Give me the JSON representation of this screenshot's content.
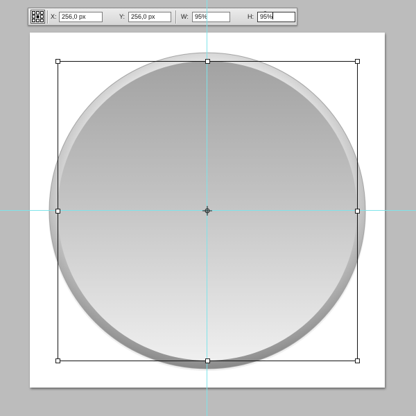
{
  "options_bar": {
    "x_label": "X:",
    "x_value": "256,0 px",
    "y_label": "Y:",
    "y_value": "256,0 px",
    "w_label": "W:",
    "w_value": "95%",
    "h_label": "H:",
    "h_value": "95%",
    "reference_point_icon": "reference-point-grid-icon",
    "relative_positioning_icon": "delta-icon",
    "link_icon": "chain-link-icon"
  },
  "canvas": {
    "background_color": "#bcbcbc",
    "document_color": "#ffffff",
    "guide_color": "#7ee4ea"
  },
  "artwork": {
    "shape": "circular button",
    "gradient_top": "#a2a2a2",
    "gradient_bottom": "#efefef",
    "rim_color": "#d0d0d0"
  },
  "transform": {
    "center_icon": "reference-point-crosshair-icon"
  }
}
